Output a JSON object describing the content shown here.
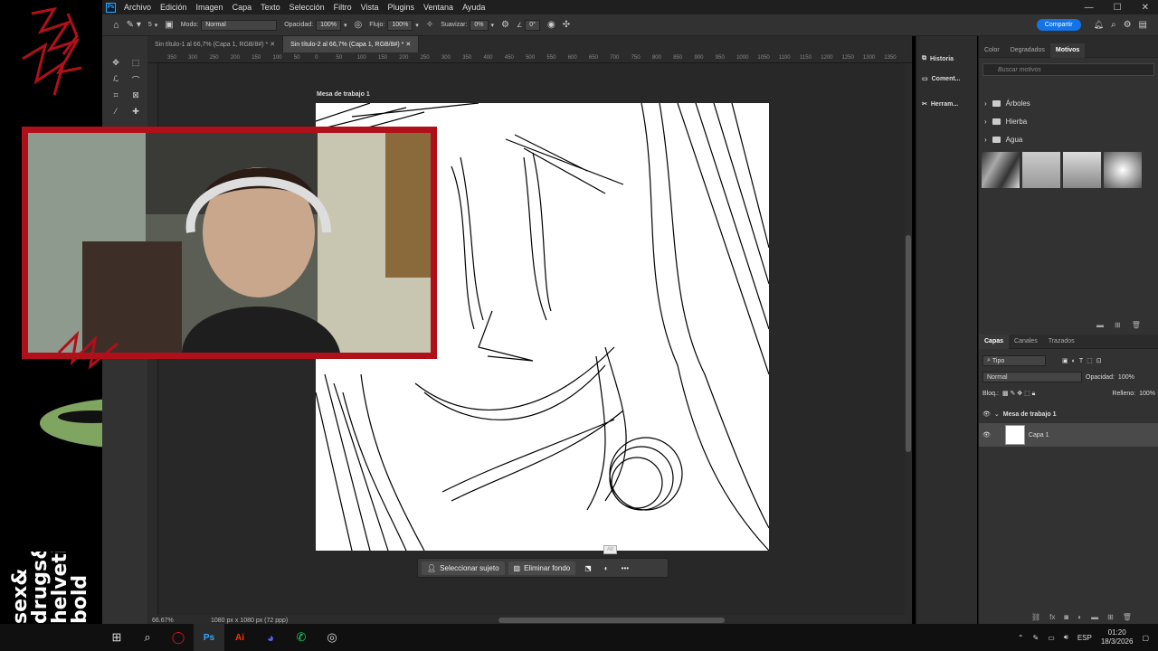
{
  "menu": [
    "Archivo",
    "Edición",
    "Imagen",
    "Capa",
    "Texto",
    "Selección",
    "Filtro",
    "Vista",
    "Plugins",
    "Ventana",
    "Ayuda"
  ],
  "options": {
    "mode_label": "Modo:",
    "mode_value": "Normal",
    "opacity_label": "Opacidad:",
    "opacity_value": "100%",
    "flow_label": "Flujo:",
    "flow_value": "100%",
    "smooth_label": "Suavizar:",
    "smooth_value": "0%",
    "angle_value": "0°",
    "brush_size": "5",
    "share_label": "Compartir"
  },
  "tabs": [
    "Sin título-1 al 66,7% (Capa 1, RGB/8#) *",
    "Sin título-2 al 66,7% (Capa 1, RGB/8#) *"
  ],
  "ruler_ticks": [
    "350",
    "300",
    "250",
    "200",
    "150",
    "100",
    "50",
    "0",
    "50",
    "100",
    "150",
    "200",
    "250",
    "300",
    "350",
    "400",
    "450",
    "500",
    "550",
    "600",
    "650",
    "700",
    "750",
    "800",
    "850",
    "900",
    "950",
    "1000",
    "1050",
    "1100",
    "1150",
    "1200",
    "1250",
    "1300",
    "1350"
  ],
  "artboard_label": "Mesa de trabajo 1",
  "status": {
    "zoom": "66.67%",
    "doc": "1080 px x 1080 px (72 ppp)"
  },
  "context_bar": {
    "select_subject": "Seleccionar sujeto",
    "remove_bg": "Eliminar fondo",
    "alt": "Alt"
  },
  "mid_panel": [
    "Historia",
    "Coment...",
    "Herram..."
  ],
  "top_panel": {
    "tabs": [
      "Color",
      "Degradados",
      "Motivos"
    ],
    "search_placeholder": "Buscar motivos",
    "folders": [
      "Árboles",
      "Hierba",
      "Agua"
    ]
  },
  "layers_panel": {
    "tabs": [
      "Capas",
      "Canales",
      "Trazados"
    ],
    "filter": "Tipo",
    "blend": "Normal",
    "opacity_label": "Opacidad:",
    "opacity_value": "100%",
    "lock_label": "Bloq.:",
    "fill_label": "Relleno:",
    "fill_value": "100%",
    "group_name": "Mesa de trabajo 1",
    "layer_name": "Capa 1"
  },
  "overlay_text": "sex&\ndrugs&\nhelvetica\nbold",
  "taskbar": {
    "lang": "ESP",
    "time": "01:20",
    "date": "18/3/2026"
  },
  "colors": {
    "accent": "#1473e6",
    "frame_red": "#b0101a",
    "ps_blue": "#31a8ff"
  }
}
